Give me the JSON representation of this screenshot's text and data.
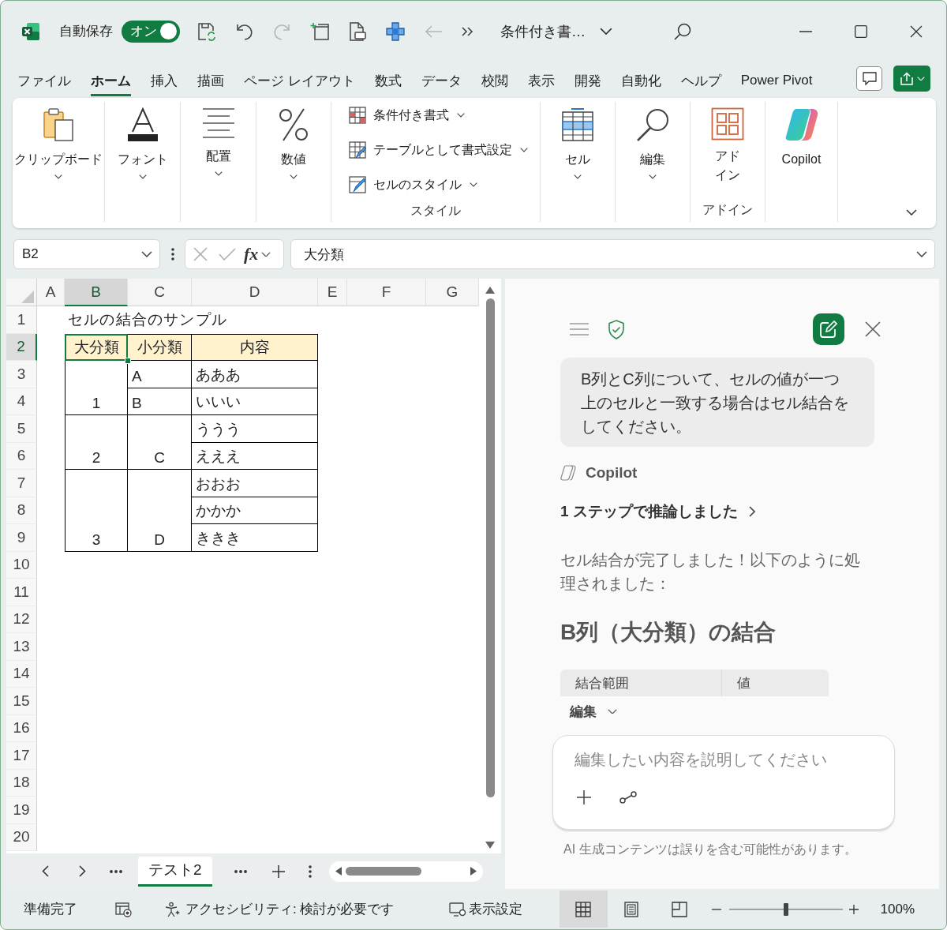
{
  "title_bar": {
    "autosave_label": "自動保存",
    "autosave": {
      "label": "オン",
      "on": true
    },
    "quick_access": [
      {
        "kind": "save",
        "disabled": false
      },
      {
        "kind": "undo",
        "disabled": false
      },
      {
        "kind": "redo",
        "disabled": true
      },
      {
        "kind": "frame",
        "disabled": false
      },
      {
        "kind": "preview",
        "disabled": false
      },
      {
        "kind": "tiles",
        "disabled": false
      },
      {
        "kind": "back",
        "disabled": true
      },
      {
        "kind": "more",
        "disabled": false
      }
    ],
    "document_title": "条件付き書…"
  },
  "menu_tabs": [
    {
      "label": "ファイル",
      "selected": false
    },
    {
      "label": "ホーム",
      "selected": true
    },
    {
      "label": "挿入",
      "selected": false
    },
    {
      "label": "描画",
      "selected": false
    },
    {
      "label": "ページ レイアウト",
      "selected": false
    },
    {
      "label": "数式",
      "selected": false
    },
    {
      "label": "データ",
      "selected": false
    },
    {
      "label": "校閲",
      "selected": false
    },
    {
      "label": "表示",
      "selected": false
    },
    {
      "label": "開発",
      "selected": false
    },
    {
      "label": "自動化",
      "selected": false
    },
    {
      "label": "ヘルプ",
      "selected": false
    },
    {
      "label": "Power Pivot",
      "selected": false
    }
  ],
  "ribbon": {
    "groups": [
      {
        "buttons": [
          {
            "kind": "clipboard",
            "label": "クリップボード",
            "dropdown": true
          }
        ]
      },
      {
        "buttons": [
          {
            "kind": "font",
            "label": "フォント",
            "dropdown": true
          }
        ]
      },
      {
        "buttons": [
          {
            "kind": "alignment",
            "label": "配置",
            "dropdown": true
          }
        ]
      },
      {
        "buttons": [
          {
            "kind": "number",
            "label": "数値",
            "dropdown": true
          }
        ]
      },
      {
        "label": "スタイル",
        "buttons": [
          {
            "kind": "conditional",
            "label": "条件付き書式",
            "dropdown": true
          },
          {
            "kind": "table",
            "label": "テーブルとして書式設定",
            "dropdown": true
          },
          {
            "kind": "cellstyle",
            "label": "セルのスタイル",
            "dropdown": true
          }
        ]
      },
      {
        "buttons": [
          {
            "kind": "cells",
            "label": "セル",
            "dropdown": true
          }
        ]
      },
      {
        "buttons": [
          {
            "kind": "editing",
            "label": "編集",
            "dropdown": true
          }
        ]
      },
      {
        "label": "アドイン",
        "buttons": [
          {
            "kind": "addins",
            "label": "アドイン",
            "dropdown": false
          }
        ]
      },
      {
        "buttons": [
          {
            "kind": "copilot",
            "label": "Copilot",
            "dropdown": false
          }
        ]
      }
    ]
  },
  "formula_bar": {
    "name_box": "B2",
    "function_label": "fx",
    "formula": "大分類"
  },
  "sheet": {
    "columns": [
      {
        "label": "A",
        "selected": false
      },
      {
        "label": "B",
        "selected": true
      },
      {
        "label": "C",
        "selected": false
      },
      {
        "label": "D",
        "selected": false
      },
      {
        "label": "E",
        "selected": false
      },
      {
        "label": "F",
        "selected": false
      },
      {
        "label": "G",
        "selected": false
      }
    ],
    "rows": [
      {
        "label": "1",
        "selected": false
      },
      {
        "label": "2",
        "selected": true
      },
      {
        "label": "3",
        "selected": false
      },
      {
        "label": "4",
        "selected": false
      },
      {
        "label": "5",
        "selected": false
      },
      {
        "label": "6",
        "selected": false
      },
      {
        "label": "7",
        "selected": false
      },
      {
        "label": "8",
        "selected": false
      },
      {
        "label": "9",
        "selected": false
      },
      {
        "label": "10",
        "selected": false
      },
      {
        "label": "11",
        "selected": false
      },
      {
        "label": "12",
        "selected": false
      },
      {
        "label": "13",
        "selected": false
      },
      {
        "label": "14",
        "selected": false
      },
      {
        "label": "15",
        "selected": false
      },
      {
        "label": "16",
        "selected": false
      },
      {
        "label": "17",
        "selected": false
      },
      {
        "label": "18",
        "selected": false
      },
      {
        "label": "19",
        "selected": false
      },
      {
        "label": "20",
        "selected": false
      }
    ],
    "title_cell": "セルの結合のサンプル",
    "table": {
      "header": [
        {
          "text": "大分類",
          "selected": true
        },
        {
          "text": "小分類",
          "selected": false
        },
        {
          "text": "内容",
          "selected": false
        }
      ],
      "rows": [
        [
          {
            "merged_above": false
          },
          {
            "text": "A",
            "merged_above": false
          },
          {
            "text": "あああ",
            "merged_above": false
          }
        ],
        [
          {
            "text": "1",
            "merged_above": true
          },
          {
            "text": "B",
            "merged_above": false
          },
          {
            "text": "いいい",
            "merged_above": false
          }
        ],
        [
          {
            "merged_above": false
          },
          {
            "merged_above": false
          },
          {
            "text": "ううう",
            "merged_above": false
          }
        ],
        [
          {
            "text": "2",
            "merged_above": true
          },
          {
            "text": "C",
            "merged_above": true
          },
          {
            "text": "えええ",
            "merged_above": false
          }
        ],
        [
          {
            "merged_above": false
          },
          {
            "merged_above": false
          },
          {
            "text": "おおお",
            "merged_above": false
          }
        ],
        [
          {
            "merged_above": true
          },
          {
            "merged_above": true
          },
          {
            "text": "かかか",
            "merged_above": false
          }
        ],
        [
          {
            "text": "3",
            "merged_above": true
          },
          {
            "text": "D",
            "merged_above": true
          },
          {
            "text": "ききき",
            "merged_above": false
          }
        ]
      ]
    }
  },
  "sheet_tabs": [
    {
      "label": "テスト2",
      "selected": true
    }
  ],
  "copilot": {
    "user_message": "B列とC列について、セルの値が一つ上のセルと一致する場合はセル結合をしてください。",
    "assistant_name": "Copilot",
    "reasoning": "1 ステップで推論しました",
    "reply": "セル結合が完了しました！以下のように処理されました：",
    "heading": "B列（大分類）の結合",
    "table_columns": [
      "結合範囲",
      "値"
    ],
    "mode": "編集",
    "composer": {
      "placeholder": "編集したい内容を説明してください"
    },
    "disclaimer": "AI 生成コンテンツは誤りを含む可能性があります。"
  },
  "status_bar": {
    "status": "準備完了",
    "accessibility": "アクセシビリティ: 検討が必要です",
    "display_settings": "表示設定",
    "views": [
      {
        "kind": "normal",
        "selected": true
      },
      {
        "kind": "layout",
        "selected": false
      },
      {
        "kind": "breaks",
        "selected": false
      }
    ],
    "zoom": {
      "level": 0.5,
      "reading": "100%"
    }
  }
}
